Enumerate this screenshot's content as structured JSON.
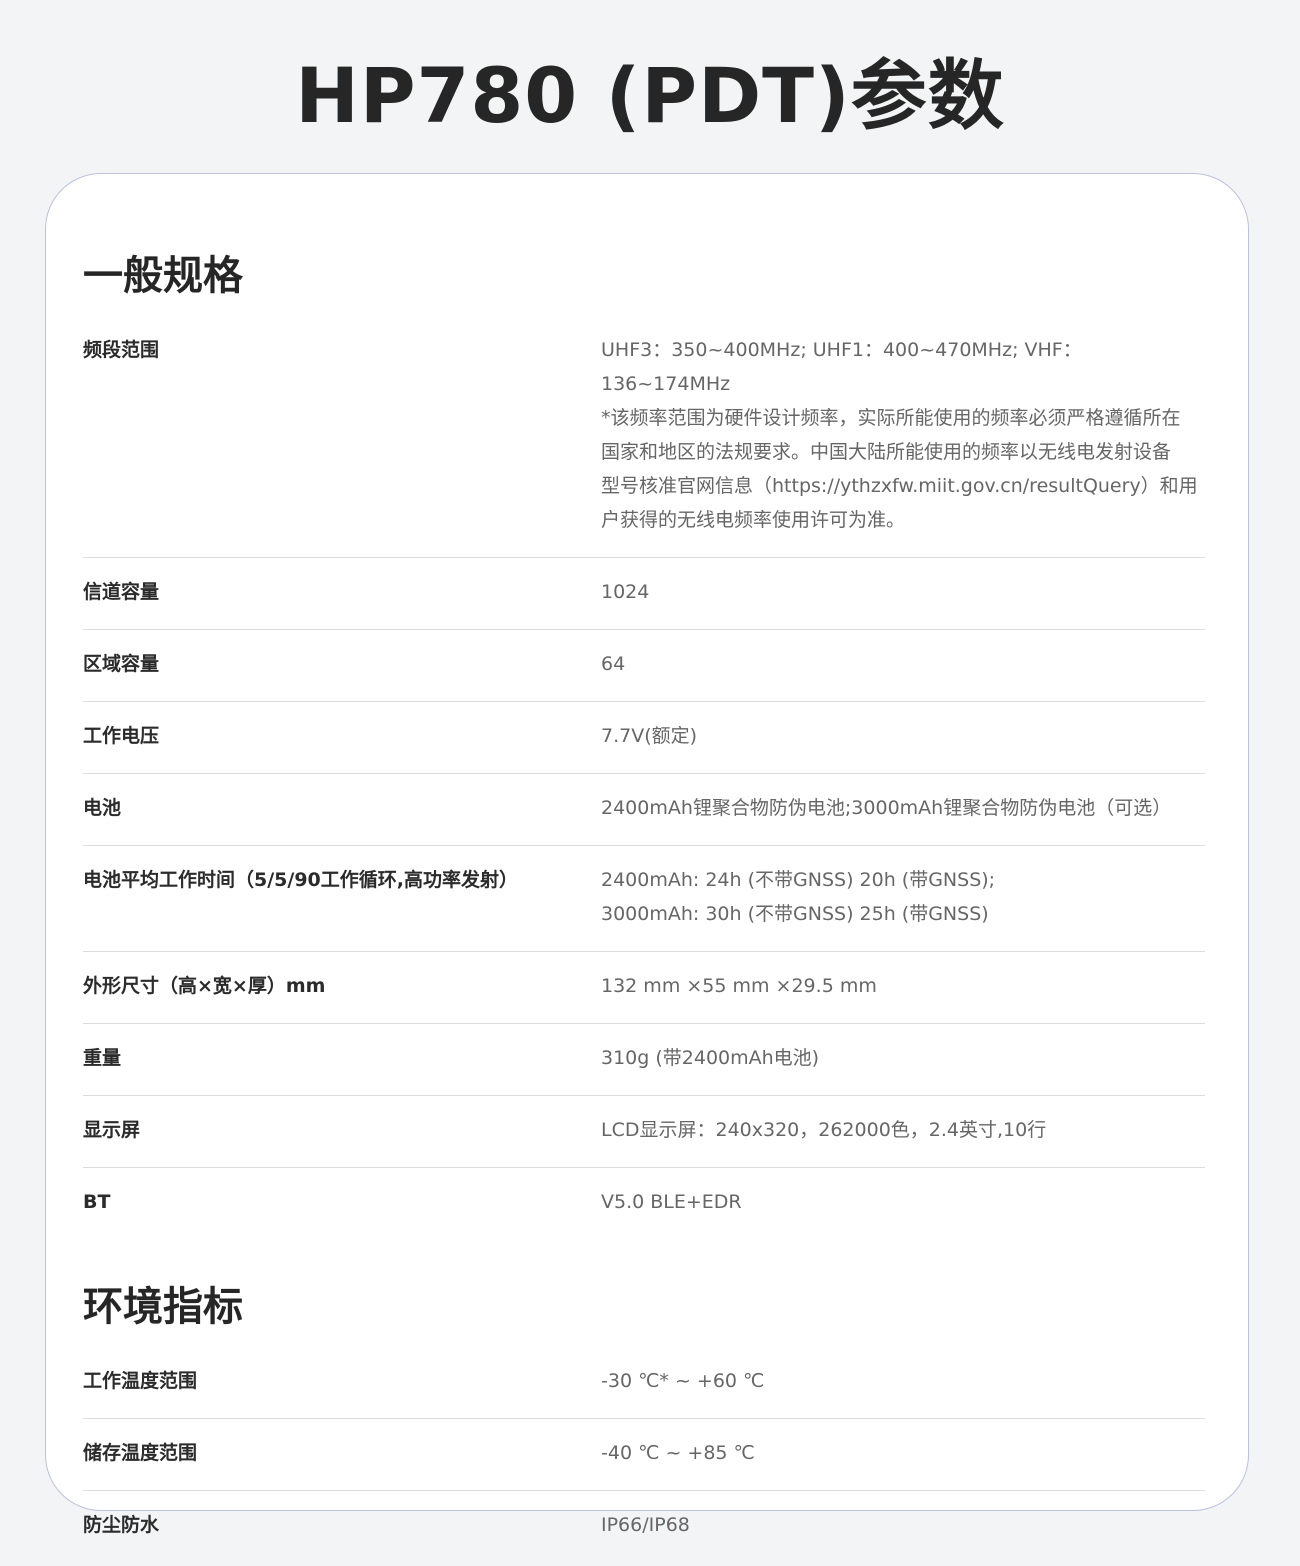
{
  "page_title": "HP780 (PDT)参数",
  "sections": [
    {
      "title": "一般规格",
      "rows": [
        {
          "label": "频段范围",
          "lines": [
            "UHF3：350~400MHz; UHF1：400~470MHz; VHF：136~174MHz",
            "*该频率范围为硬件设计频率，实际所能使用的频率必须严格遵循所在",
            "国家和地区的法规要求。中国大陆所能使用的频率以无线电发射设备",
            "型号核准官网信息（https://ythzxfw.miit.gov.cn/resultQuery）和用",
            "户获得的无线电频率使用许可为准。"
          ]
        },
        {
          "label": "信道容量",
          "lines": [
            "1024"
          ]
        },
        {
          "label": "区域容量",
          "lines": [
            "64"
          ]
        },
        {
          "label": "工作电压",
          "lines": [
            "7.7V(额定)"
          ]
        },
        {
          "label": "电池",
          "lines": [
            "2400mAh锂聚合物防伪电池;3000mAh锂聚合物防伪电池（可选）"
          ]
        },
        {
          "label": "电池平均工作时间（5/5/90工作循环,高功率发射）",
          "lines": [
            "2400mAh: 24h (不带GNSS) 20h (带GNSS);",
            "3000mAh: 30h (不带GNSS) 25h (带GNSS)"
          ]
        },
        {
          "label": "外形尺寸（高×宽×厚）mm",
          "lines": [
            "132 mm ×55 mm ×29.5 mm"
          ]
        },
        {
          "label": "重量",
          "lines": [
            "310g (带2400mAh电池)"
          ]
        },
        {
          "label": "显示屏",
          "lines": [
            "LCD显示屏：240x320，262000色，2.4英寸,10行"
          ]
        },
        {
          "label": "BT",
          "lines": [
            "V5.0 BLE+EDR"
          ]
        }
      ]
    },
    {
      "title": "环境指标",
      "rows": [
        {
          "label": "工作温度范围",
          "lines": [
            "-30 ℃* ~ +60 ℃"
          ]
        },
        {
          "label": "储存温度范围",
          "lines": [
            "-40 ℃ ~ +85 ℃"
          ]
        },
        {
          "label": "防尘防水",
          "lines": [
            "IP66/IP68"
          ]
        }
      ]
    }
  ]
}
